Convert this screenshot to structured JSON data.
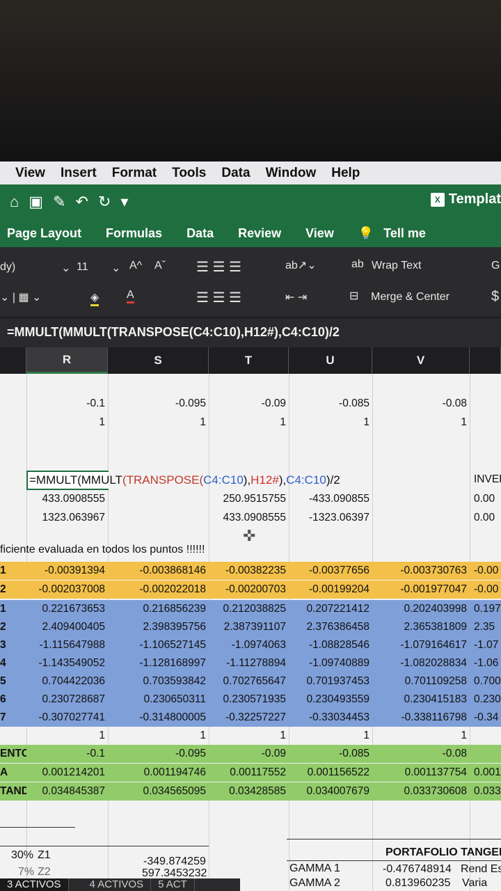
{
  "menu": [
    "View",
    "Insert",
    "Format",
    "Tools",
    "Data",
    "Window",
    "Help"
  ],
  "toolbar": {
    "icons": [
      "home-icon",
      "save-icon",
      "edit-icon",
      "undo-icon",
      "redo-icon",
      "customize-icon"
    ],
    "doc_title": "Templat",
    "excel_badge": "X"
  },
  "ribbon_tabs": [
    "Page Layout",
    "Formulas",
    "Data",
    "Review",
    "View",
    "Tell me"
  ],
  "ribbon": {
    "font_name": "dy)",
    "font_size": "11",
    "grow": "A^",
    "shrink": "Aˇ",
    "wrap_text": "Wrap Text",
    "merge_center": "Merge & Center",
    "general": "G",
    "currency": "$"
  },
  "formula_bar": "=MMULT(MMULT(TRANSPOSE(C4:C10),H12#),C4:C10)/2",
  "columns": [
    "R",
    "S",
    "T",
    "U",
    "V"
  ],
  "selected_column": "R",
  "cell_formula": [
    {
      "t": "=MMULT(MMULT",
      "c": "#111"
    },
    {
      "t": "(TRANSPOSE(",
      "c": "#c0392b"
    },
    {
      "t": "C4:C10",
      "c": "#2e5fc9"
    },
    {
      "t": "),",
      "c": "#111"
    },
    {
      "t": "H12#",
      "c": "#d0312d"
    },
    {
      "t": "),",
      "c": "#111"
    },
    {
      "t": "C4:C10",
      "c": "#2e5fc9"
    },
    {
      "t": ")/2",
      "c": "#111"
    }
  ],
  "note": "ficiente evaluada en todos los puntos !!!!!!",
  "colors": {
    "yellow": "#f3c14a",
    "blue": "#7f9fd8",
    "green": "#92cc6a",
    "excel_green": "#1f6e3f"
  },
  "grid": [
    {
      "band": "",
      "cells": [
        "",
        "-0.1",
        "-0.095",
        "-0.09",
        "-0.085",
        "-0.08",
        ""
      ]
    },
    {
      "band": "",
      "cells": [
        "",
        "1",
        "1",
        "1",
        "1",
        "1",
        ""
      ]
    },
    {
      "band": "",
      "cells": [
        "",
        "",
        "",
        "",
        "",
        "",
        ""
      ]
    },
    {
      "band": "",
      "cells": [
        "",
        "",
        "",
        "",
        "",
        "",
        ""
      ]
    },
    {
      "band": "",
      "cells": [
        "",
        "",
        "",
        "",
        "",
        "",
        "INVEF"
      ]
    },
    {
      "band": "",
      "cells": [
        "",
        "433.0908555",
        "",
        "250.9515755",
        "-433.090855",
        "",
        "0.00"
      ]
    },
    {
      "band": "",
      "cells": [
        "",
        "1323.063967",
        "",
        "433.0908555",
        "-1323.06397",
        "",
        "0.00"
      ]
    },
    {
      "band": "",
      "cells": [
        "",
        "",
        "",
        "",
        "",
        "",
        ""
      ]
    },
    {
      "band": "",
      "cells": [
        "",
        "",
        "",
        "",
        "",
        "",
        ""
      ]
    },
    {
      "band": "yellow",
      "cells": [
        "1",
        "-0.00391394",
        "-0.003868146",
        "-0.00382235",
        "-0.00377656",
        "-0.003730763",
        "-0.00"
      ]
    },
    {
      "band": "yellow",
      "cells": [
        "2",
        "-0.002037008",
        "-0.002022018",
        "-0.00200703",
        "-0.00199204",
        "-0.001977047",
        "-0.00"
      ]
    },
    {
      "band": "blue",
      "cells": [
        "1",
        "0.221673653",
        "0.216856239",
        "0.212038825",
        "0.207221412",
        "0.202403998",
        "0.197"
      ]
    },
    {
      "band": "blue",
      "cells": [
        "2",
        "2.409400405",
        "2.398395756",
        "2.387391107",
        "2.376386458",
        "2.365381809",
        "2.35"
      ]
    },
    {
      "band": "blue",
      "cells": [
        "3",
        "-1.115647988",
        "-1.106527145",
        "-1.0974063",
        "-1.08828546",
        "-1.079164617",
        "-1.07"
      ]
    },
    {
      "band": "blue",
      "cells": [
        "4",
        "-1.143549052",
        "-1.128168997",
        "-1.11278894",
        "-1.09740889",
        "-1.082028834",
        "-1.06"
      ]
    },
    {
      "band": "blue",
      "cells": [
        "5",
        "0.704422036",
        "0.703593842",
        "0.702765647",
        "0.701937453",
        "0.701109258",
        "0.700"
      ]
    },
    {
      "band": "blue",
      "cells": [
        "6",
        "0.230728687",
        "0.230650311",
        "0.230571935",
        "0.230493559",
        "0.230415183",
        "0.230"
      ]
    },
    {
      "band": "blue",
      "cells": [
        "7",
        "-0.307027741",
        "-0.314800005",
        "-0.32257227",
        "-0.33034453",
        "-0.338116798",
        "-0.34"
      ]
    },
    {
      "band": "",
      "cells": [
        "",
        "1",
        "1",
        "1",
        "1",
        "1",
        ""
      ]
    },
    {
      "band": "green",
      "cells": [
        "ENTO",
        "-0.1",
        "-0.095",
        "-0.09",
        "-0.085",
        "-0.08",
        ""
      ]
    },
    {
      "band": "green",
      "cells": [
        "A",
        "0.001214201",
        "0.001194746",
        "0.00117552",
        "0.001156522",
        "0.001137754",
        "0.0011"
      ]
    },
    {
      "band": "green",
      "cells": [
        "TANDA",
        "0.034845387",
        "0.034565095",
        "0.03428585",
        "0.034007679",
        "0.033730608",
        "0.0334"
      ]
    }
  ],
  "bottom": {
    "z1_pct": "30%",
    "z1_label": "Z1",
    "z1_value": "-349.874259",
    "z2_pct": "7%",
    "z2_label": "Z2",
    "z2_value": "597.3453232",
    "portfolio_title": "PORTAFOLIO TANGEN",
    "gamma1_label": "GAMMA 1",
    "gamma1_value": "-0.476748914",
    "gamma1_extra": "Rend Es",
    "gamma2_label": "GAMMA 2",
    "gamma2_value": "0.813960235",
    "gamma2_extra": "Varia"
  },
  "sheet_tabs": [
    "3 ACTIVOS",
    "4 ACTIVOS",
    "5 ACT"
  ]
}
